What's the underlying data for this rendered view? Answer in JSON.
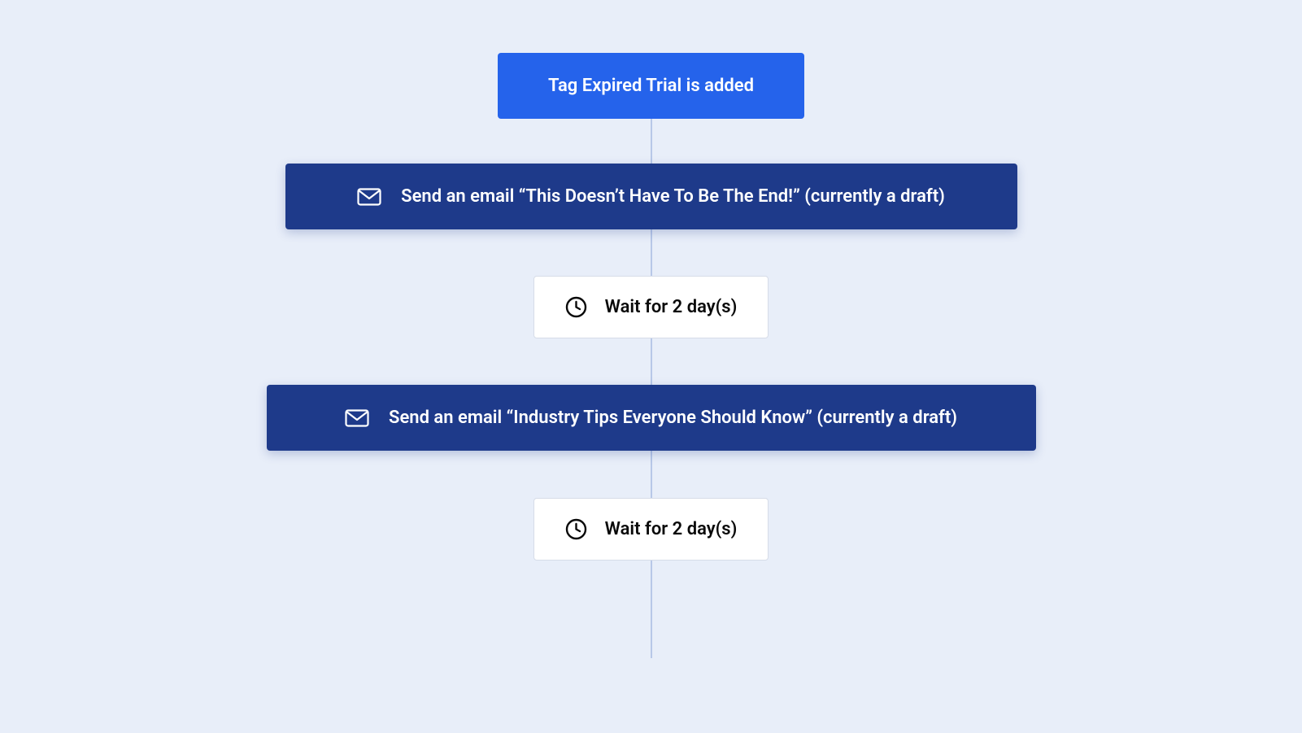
{
  "workflow": {
    "trigger": {
      "label": "Tag Expired Trial is added"
    },
    "steps": [
      {
        "type": "email",
        "label": "Send an email “This Doesn’t Have To Be The End!” (currently a draft)",
        "icon": "envelope-icon"
      },
      {
        "type": "wait",
        "label": "Wait for 2 day(s)",
        "icon": "clock-icon"
      },
      {
        "type": "email",
        "label": "Send an email “Industry Tips Everyone Should Know” (currently a draft)",
        "icon": "envelope-icon"
      },
      {
        "type": "wait",
        "label": "Wait for 2 day(s)",
        "icon": "clock-icon"
      }
    ]
  },
  "colors": {
    "background": "#e8eef9",
    "trigger": "#2563eb",
    "email": "#1e3a8a",
    "wait": "#ffffff",
    "connector": "#b8c8e8"
  }
}
